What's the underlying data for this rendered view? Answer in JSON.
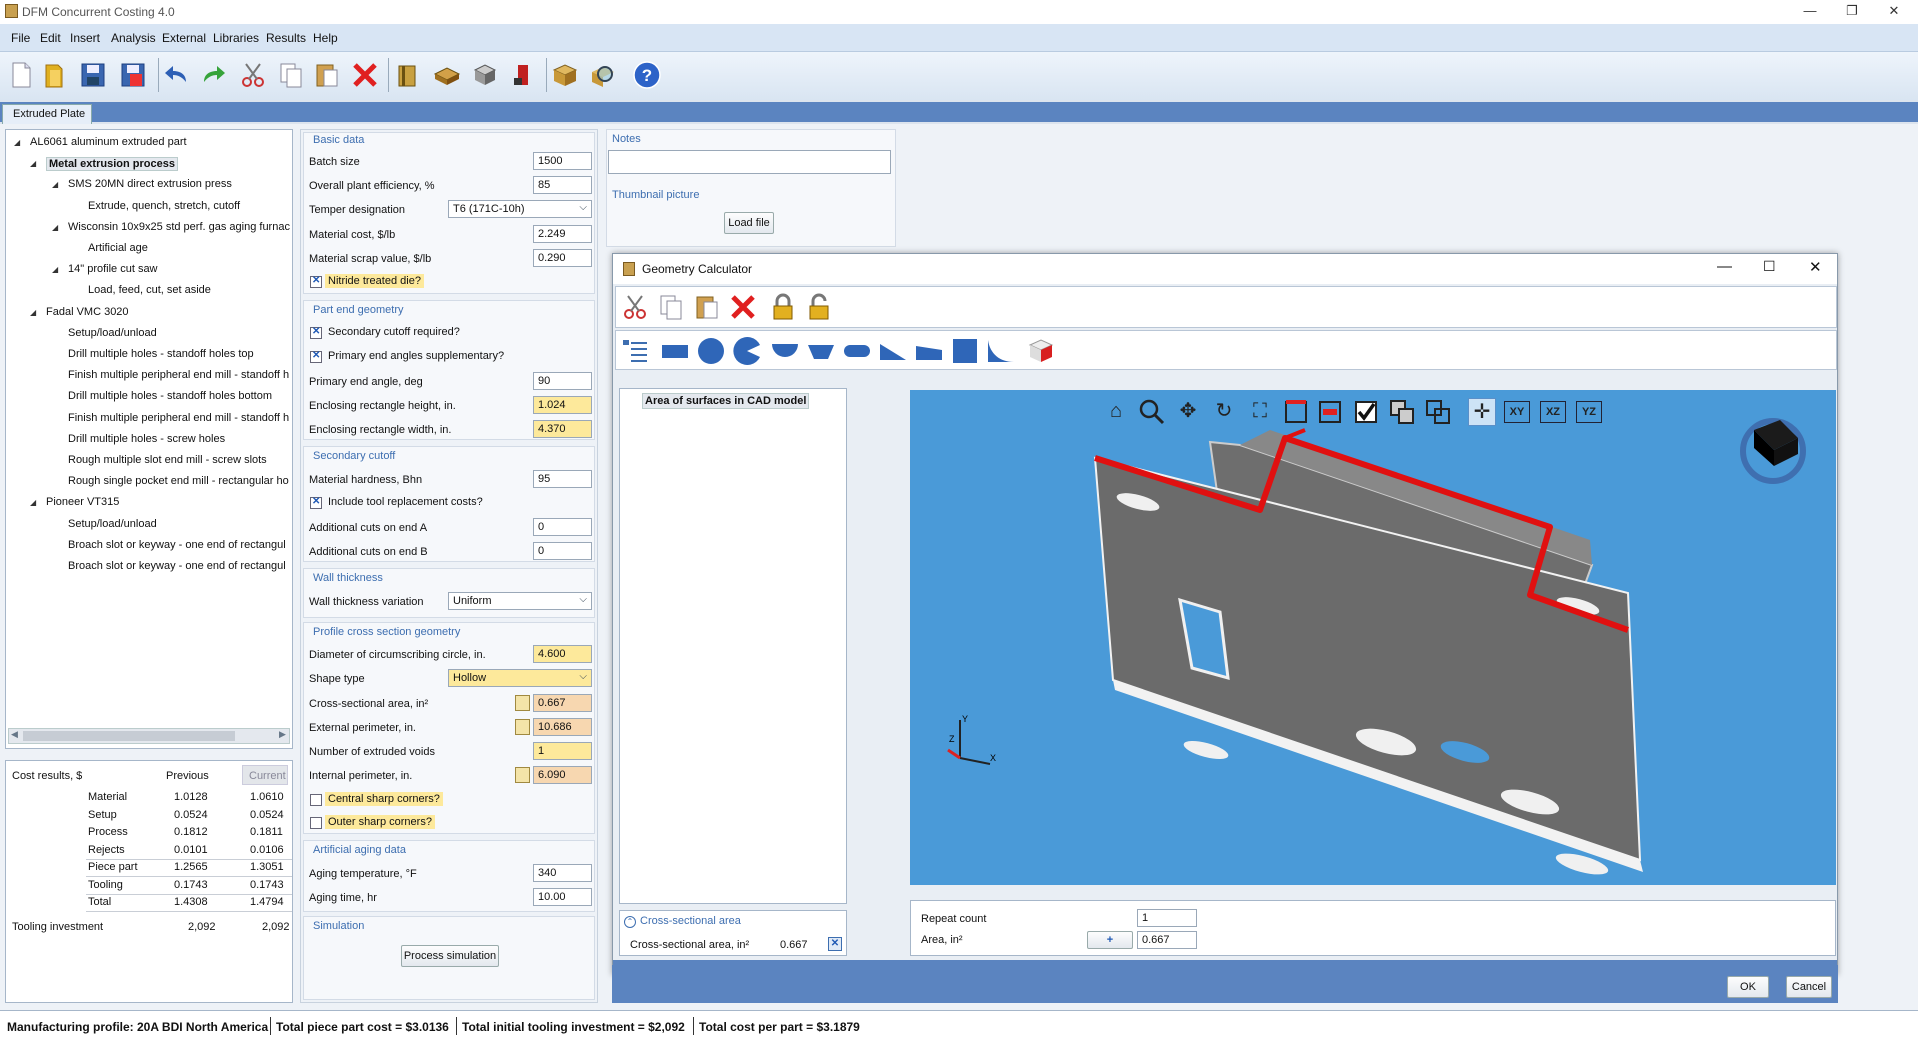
{
  "window": {
    "title": "DFM Concurrent Costing 4.0"
  },
  "menu": [
    "File",
    "Edit",
    "Insert",
    "Analysis",
    "External",
    "Libraries",
    "Results",
    "Help"
  ],
  "tab": {
    "label": "Extruded Plate"
  },
  "tree": [
    {
      "label": "AL6061 aluminum extruded part",
      "level": 0,
      "expanded": true
    },
    {
      "label": "Metal extrusion process",
      "level": 1,
      "expanded": true,
      "selected": true
    },
    {
      "label": "SMS 20MN direct extrusion press",
      "level": 2,
      "expanded": true
    },
    {
      "label": "Extrude, quench, stretch, cutoff",
      "level": 3
    },
    {
      "label": "Wisconsin 10x9x25 std perf. gas aging furnac",
      "level": 2,
      "expanded": true
    },
    {
      "label": "Artificial age",
      "level": 3
    },
    {
      "label": "14\" profile cut saw",
      "level": 2,
      "expanded": true
    },
    {
      "label": "Load, feed, cut, set aside",
      "level": 3
    },
    {
      "label": "Fadal VMC 3020",
      "level": 1,
      "expanded": true
    },
    {
      "label": "Setup/load/unload",
      "level": 2
    },
    {
      "label": "Drill multiple holes - standoff holes top",
      "level": 2
    },
    {
      "label": "Finish multiple peripheral end mill - standoff h",
      "level": 2
    },
    {
      "label": "Drill multiple holes - standoff holes bottom",
      "level": 2
    },
    {
      "label": "Finish multiple peripheral end mill - standoff h",
      "level": 2
    },
    {
      "label": "Drill multiple holes - screw holes",
      "level": 2
    },
    {
      "label": "Rough multiple slot end mill - screw slots",
      "level": 2
    },
    {
      "label": "Rough single pocket end mill - rectangular ho",
      "level": 2
    },
    {
      "label": "Pioneer VT315",
      "level": 1,
      "expanded": true
    },
    {
      "label": "Setup/load/unload",
      "level": 2
    },
    {
      "label": "Broach slot or keyway - one end of rectangul",
      "level": 2
    },
    {
      "label": "Broach slot or keyway - one end of rectangul",
      "level": 2
    }
  ],
  "cost": {
    "title": "Cost results, $",
    "col_prev": "Previous",
    "col_cur": "Current",
    "rows": [
      {
        "label": "Material",
        "prev": "1.0128",
        "cur": "1.0610"
      },
      {
        "label": "Setup",
        "prev": "0.0524",
        "cur": "0.0524"
      },
      {
        "label": "Process",
        "prev": "0.1812",
        "cur": "0.1811"
      },
      {
        "label": "Rejects",
        "prev": "0.0101",
        "cur": "0.0106"
      },
      {
        "label": "Piece part",
        "prev": "1.2565",
        "cur": "1.3051"
      },
      {
        "label": "Tooling",
        "prev": "0.1743",
        "cur": "0.1743"
      },
      {
        "label": "Total",
        "prev": "1.4308",
        "cur": "1.4794"
      }
    ],
    "tooling_label": "Tooling investment",
    "tooling_prev": "2,092",
    "tooling_cur": "2,092"
  },
  "form": {
    "basic": "Basic data",
    "batch_size": {
      "label": "Batch size",
      "value": "1500"
    },
    "efficiency": {
      "label": "Overall plant efficiency, %",
      "value": "85"
    },
    "temper": {
      "label": "Temper designation",
      "value": "T6 (171C-10h)"
    },
    "mat_cost": {
      "label": "Material cost, $/lb",
      "value": "2.249"
    },
    "scrap": {
      "label": "Material scrap value, $/lb",
      "value": "0.290"
    },
    "nitride": "Nitride treated die?",
    "part_end": "Part end geometry",
    "sec_cutoff_req": "Secondary cutoff required?",
    "primary_angles": "Primary end angles supplementary?",
    "primary_angle": {
      "label": "Primary end angle, deg",
      "value": "90"
    },
    "rect_h": {
      "label": "Enclosing rectangle height, in.",
      "value": "1.024"
    },
    "rect_w": {
      "label": "Enclosing rectangle width, in.",
      "value": "4.370"
    },
    "secondary": "Secondary cutoff",
    "hardness": {
      "label": "Material hardness, Bhn",
      "value": "95"
    },
    "tool_repl": "Include tool replacement costs?",
    "cuts_a": {
      "label": "Additional cuts on end A",
      "value": "0"
    },
    "cuts_b": {
      "label": "Additional cuts on end B",
      "value": "0"
    },
    "wall": "Wall thickness",
    "wall_var": {
      "label": "Wall thickness variation",
      "value": "Uniform"
    },
    "profile": "Profile cross section geometry",
    "diameter": {
      "label": "Diameter of circumscribing circle, in.",
      "value": "4.600"
    },
    "shape": {
      "label": "Shape type",
      "value": "Hollow"
    },
    "area": {
      "label": "Cross-sectional area, in²",
      "value": "0.667"
    },
    "ext_perim": {
      "label": "External perimeter, in.",
      "value": "10.686"
    },
    "voids": {
      "label": "Number of extruded voids",
      "value": "1"
    },
    "int_perim": {
      "label": "Internal perimeter, in.",
      "value": "6.090"
    },
    "central": "Central sharp corners?",
    "outer": "Outer sharp corners?",
    "aging": "Artificial aging data",
    "aging_temp": {
      "label": "Aging temperature, °F",
      "value": "340"
    },
    "aging_time": {
      "label": "Aging time, hr",
      "value": "10.00"
    },
    "simulation": "Simulation",
    "process_sim": "Process simulation"
  },
  "notes": {
    "label": "Notes",
    "thumb": "Thumbnail picture",
    "load": "Load file"
  },
  "geo": {
    "title": "Geometry Calculator",
    "list_item": "Area of surfaces in CAD model",
    "section": "Cross-sectional area",
    "area_label": "Cross-sectional area, in²",
    "area_value": "0.667",
    "repeat_label": "Repeat count",
    "repeat_value": "1",
    "area2_label": "Area, in²",
    "area2_value": "0.667",
    "ok": "OK",
    "cancel": "Cancel",
    "views": [
      "XY",
      "XZ",
      "YZ"
    ]
  },
  "status": {
    "profile": "Manufacturing profile: 20A BDI North America",
    "piece": "Total piece part cost = $3.0136",
    "tooling": "Total initial tooling investment = $2,092",
    "total": "Total cost per part = $3.1879"
  },
  "colors": {
    "accent": "#5b84c0",
    "field_yellow": "#fde99b",
    "field_orange": "#f7d7b0",
    "viewport": "#4a9ad8"
  }
}
